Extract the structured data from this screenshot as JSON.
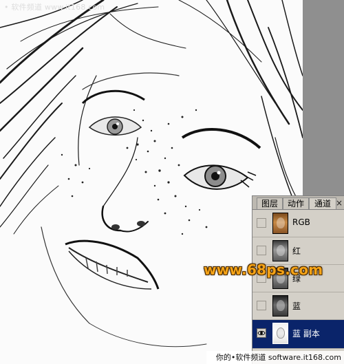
{
  "watermark_top": "• 软件频道 www.it168.com",
  "watermark_center": "www.68ps.com",
  "credit_bottom": "你的•软件频道  software.it168.com",
  "panel": {
    "tabs": [
      {
        "label": "图层"
      },
      {
        "label": "动作"
      },
      {
        "label": "通道"
      }
    ],
    "active_tab": "通道",
    "close_glyph": "×",
    "channels": [
      {
        "label": "RGB",
        "visible": false,
        "selected": false,
        "thumb": "rgb"
      },
      {
        "label": "红",
        "visible": false,
        "selected": false,
        "thumb": "red"
      },
      {
        "label": "绿",
        "visible": false,
        "selected": false,
        "thumb": "green"
      },
      {
        "label": "蓝",
        "visible": false,
        "selected": false,
        "thumb": "blue"
      },
      {
        "label": "蓝 副本",
        "visible": true,
        "selected": true,
        "thumb": "copy"
      }
    ]
  },
  "colors": {
    "selection": "#0a246a",
    "panel_bg": "#d4d0c8",
    "watermark_orange": "#f5a316",
    "workspace_gray": "#8f8f8f"
  },
  "icons": {
    "visibility": "eye-icon",
    "close": "close-icon"
  }
}
